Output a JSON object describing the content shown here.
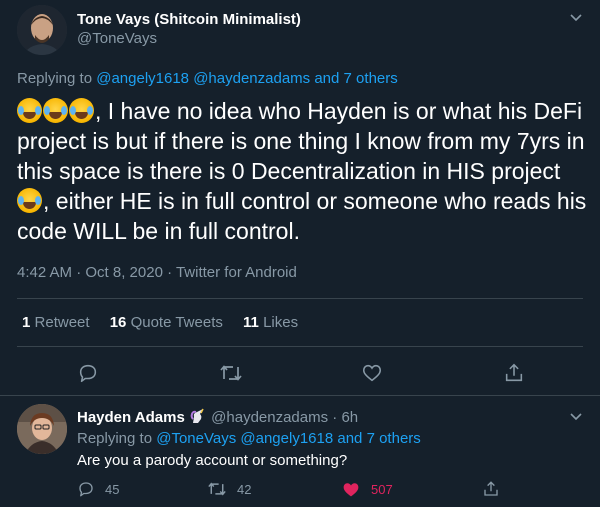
{
  "main_tweet": {
    "author": {
      "display_name": "Tone Vays (Shitcoin Minimalist)",
      "handle": "@ToneVays"
    },
    "replying": {
      "prefix": "Replying to ",
      "user1": "@angely1618",
      "user2": "@haydenzadams",
      "and_label": " and ",
      "others": "7 others"
    },
    "text": {
      "part1": ", I have no idea who Hayden is or what his DeFi project is but if there is one thing I know from my 7yrs in this space is there is 0 Decentralization in HIS project ",
      "part2": ", either HE is in full control or someone who reads his code WILL be in full control."
    },
    "timestamp": "4:42 AM · Oct 8, 2020 · Twitter for Android",
    "stats": {
      "retweets_count": "1",
      "retweets_label": "Retweet",
      "quotes_count": "16",
      "quotes_label": "Quote Tweets",
      "likes_count": "11",
      "likes_label": "Likes"
    }
  },
  "reply_tweet": {
    "display_name": "Hayden Adams",
    "handle": "@haydenzadams",
    "time": " · 6h",
    "replying": {
      "prefix": "Replying to ",
      "user1": "@ToneVays",
      "user2": "@angely1618",
      "and_label": " and ",
      "others": "7 others"
    },
    "text": "Are you a parody account or something?",
    "replies": "45",
    "retweets": "42",
    "likes": "507"
  },
  "colors": {
    "background": "#15202b",
    "text": "#ffffff",
    "secondary": "#8899a6",
    "link": "#1da1f2",
    "border": "#38444d",
    "like": "#e0245e"
  },
  "icons": [
    "caret-down-icon",
    "laughing-tears-emoji",
    "reply-icon",
    "retweet-icon",
    "heart-icon",
    "share-icon",
    "unicorn-emoji"
  ]
}
